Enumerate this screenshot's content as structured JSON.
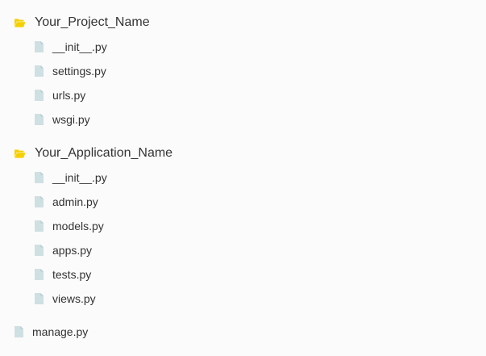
{
  "colors": {
    "folder_icon": "#f5d000",
    "file_icon": "#cfe0e3",
    "file_icon_fold": "#b7cdd1",
    "text": "#333333",
    "background": "#fbfbfb"
  },
  "tree": {
    "project_folder": {
      "name": "Your_Project_Name",
      "icon": "folder-open-icon",
      "files": [
        "__init__.py",
        "settings.py",
        "urls.py",
        "wsgi.py"
      ]
    },
    "application_folder": {
      "name": "Your_Application_Name",
      "icon": "folder-open-icon",
      "files": [
        "__init__.py",
        "admin.py",
        "models.py",
        "apps.py",
        "tests.py",
        "views.py"
      ]
    },
    "root_file": {
      "name": "manage.py",
      "icon": "file-icon"
    }
  }
}
